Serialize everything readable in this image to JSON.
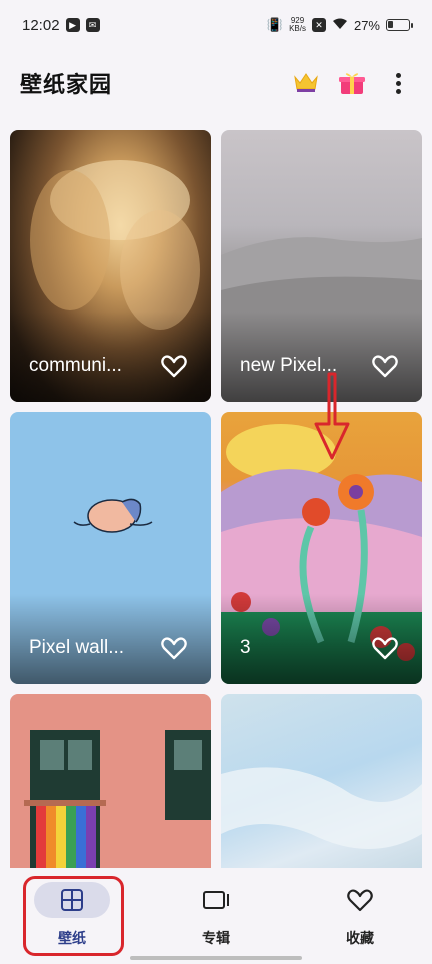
{
  "status_bar": {
    "time": "12:02",
    "net_speed_value": "929",
    "net_speed_unit": "KB/s",
    "battery_percent": "27%",
    "battery_level": 0.27
  },
  "header": {
    "title": "壁纸家园"
  },
  "cards": [
    {
      "label": "communi..."
    },
    {
      "label": "new Pixel..."
    },
    {
      "label": "Pixel wall..."
    },
    {
      "label": "3"
    },
    {
      "label": ""
    },
    {
      "label": ""
    }
  ],
  "bottom_nav": [
    {
      "label": "壁纸",
      "icon": "grid-icon",
      "active": true
    },
    {
      "label": "专辑",
      "icon": "album-icon",
      "active": false
    },
    {
      "label": "收藏",
      "icon": "heart-icon",
      "active": false
    }
  ],
  "colors": {
    "accent": "#2d3e8a",
    "annotation": "#d9262c"
  }
}
